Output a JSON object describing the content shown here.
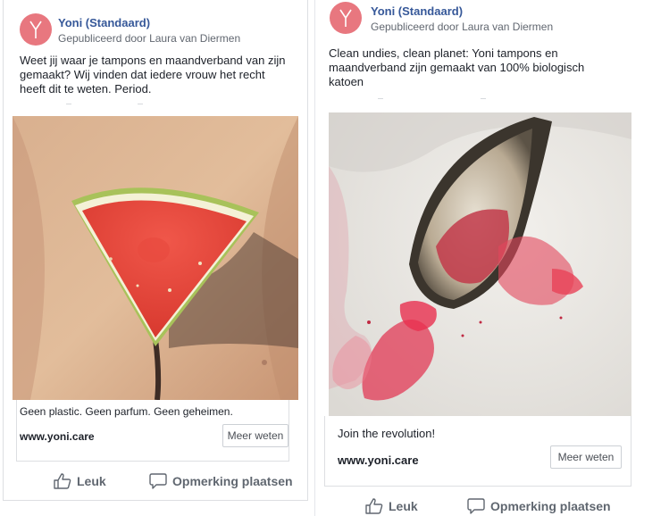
{
  "posts": [
    {
      "page_name": "Yoni (Standaard)",
      "byline": "Gepubliceerd door Laura van Diermen",
      "avatar_letter": "Y",
      "caption": "Weet jij waar je tampons en maandverband van zijn gemaakt? Wij vinden dat iedere vrouw het recht heeft dit te weten. Period.",
      "image_subject": "watermelon-slice-on-skin",
      "headline": "Geen plastic. Geen parfum. Geen geheimen.",
      "domain": "www.yoni.care",
      "cta_label": "Meer weten",
      "like_label": "Leuk",
      "comment_label": "Opmerking plaatsen"
    },
    {
      "page_name": "Yoni (Standaard)",
      "byline": "Gepubliceerd door Laura van Diermen",
      "avatar_letter": "Y",
      "caption": "Clean undies, clean planet: Yoni tampons en maandverband zijn gemaakt van 100% biologisch katoen",
      "image_subject": "oyster-with-red-liquid",
      "headline": "Join the revolution!",
      "domain": "www.yoni.care",
      "cta_label": "Meer weten",
      "like_label": "Leuk",
      "comment_label": "Opmerking plaatsen"
    }
  ],
  "colors": {
    "brand_avatar": "#e8777f",
    "page_name": "#365899",
    "action_text": "#606770"
  }
}
